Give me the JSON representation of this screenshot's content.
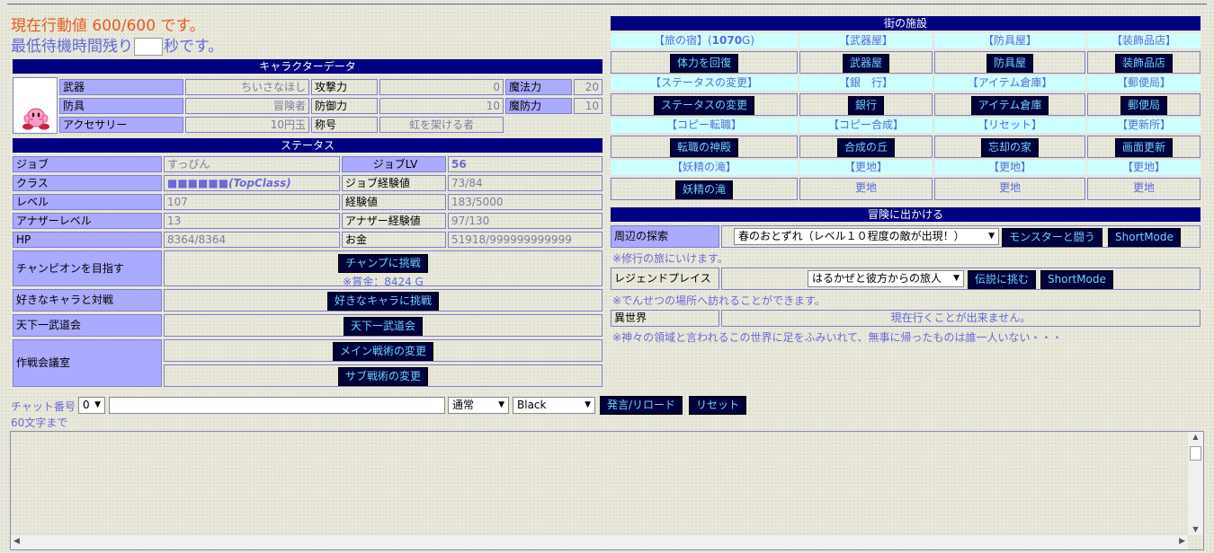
{
  "top": {
    "ap_line": "現在行動値 600/600 です。",
    "wait_prefix": "最低待機時間残り",
    "wait_suffix": "秒です。",
    "wait_value": ""
  },
  "character": {
    "header": "キャラクターデータ",
    "avatar_icon": "kirby-icon",
    "weapon_label": "武器",
    "weapon_value": "ちいさなほし",
    "armor_label": "防具",
    "armor_value": "冒険者",
    "accessory_label": "アクセサリー",
    "accessory_value": "10円玉",
    "attack_label": "攻撃力",
    "attack_value": "0",
    "defense_label": "防御力",
    "defense_value": "10",
    "title_label": "称号",
    "title_value": "虹を架ける者",
    "magic_label": "魔法力",
    "magic_value": "20",
    "mdef_label": "魔防力",
    "mdef_value": "10"
  },
  "status": {
    "header": "ステータス",
    "job_label": "ジョブ",
    "job_value": "すっぴん",
    "joblv_label": "ジョブLV",
    "joblv_value": "56",
    "class_label": "クラス",
    "class_value": "■■■■■■(TopClass)",
    "jobexp_label": "ジョブ経験値",
    "jobexp_value": "73/84",
    "level_label": "レベル",
    "level_value": "107",
    "exp_label": "経験値",
    "exp_value": "183/5000",
    "alevel_label": "アナザーレベル",
    "alevel_value": "13",
    "aexp_label": "アナザー経験値",
    "aexp_value": "97/130",
    "hp_label": "HP",
    "hp_value": "8364/8364",
    "money_label": "お金",
    "money_value": "51918/999999999999"
  },
  "actions": {
    "champion_label": "チャンピオンを目指す",
    "champion_button": "チャンプに挑戦",
    "champion_prize": "※賞金：8424 G",
    "fav_label": "好きなキャラと対戦",
    "fav_button": "好きなキャラに挑戦",
    "tenka_label": "天下一武道会",
    "tenka_button": "天下一武道会",
    "council_label": "作戦会議室",
    "main_tactic_button": "メイン戦術の変更",
    "sub_tactic_button": "サブ戦術の変更"
  },
  "town": {
    "header": "街の施設",
    "inn_prefix": "【旅の宿】(",
    "inn_price": "1070",
    "inn_suffix": "G)",
    "names": [
      "【武器屋】",
      "【防具屋】",
      "【装飾品店】",
      "【ステータスの変更】",
      "【銀　行】",
      "【アイテム倉庫】",
      "【郵便局】",
      "【コピー転職】",
      "【コピー合成】",
      "【リセット】",
      "【更新所】",
      "【妖精の滝】",
      "【更地】",
      "【更地】",
      "【更地】"
    ],
    "buttons": [
      "体力を回復",
      "武器屋",
      "防具屋",
      "装飾品店",
      "ステータスの変更",
      "銀行",
      "アイテム倉庫",
      "郵便局",
      "転職の神殿",
      "合成の丘",
      "忘却の家",
      "画面更新",
      "妖精の滝"
    ],
    "vacant": [
      "更地",
      "更地",
      "更地"
    ]
  },
  "adventure": {
    "header": "冒険に出かける",
    "explore_label": "周辺の探索",
    "explore_select": "春のおとずれ（レベル１０程度の敵が出現！）",
    "explore_fight_button": "モンスターと闘う",
    "explore_short_button": "ShortMode",
    "explore_note": "※修行の旅にいけます。",
    "legend_label": "レジェンドプレイス",
    "legend_select": "はるかぜと彼方からの旅人",
    "legend_button": "伝説に挑む",
    "legend_short_button": "ShortMode",
    "legend_note": "※でんせつの場所へ訪れることができます。",
    "other_label": "異世界",
    "other_value": "現在行くことが出来ません。",
    "other_note": "※神々の領域と言われるこの世界に足をふみいれて、無事に帰ったものは誰一人いない・・・"
  },
  "chat": {
    "label": "チャット番号",
    "number_select": "0",
    "message_value": "",
    "mode_select": "通常",
    "color_select": "Black",
    "send_button": "発言/リロード",
    "reset_button": "リセット",
    "limit_note": "60文字まで"
  }
}
